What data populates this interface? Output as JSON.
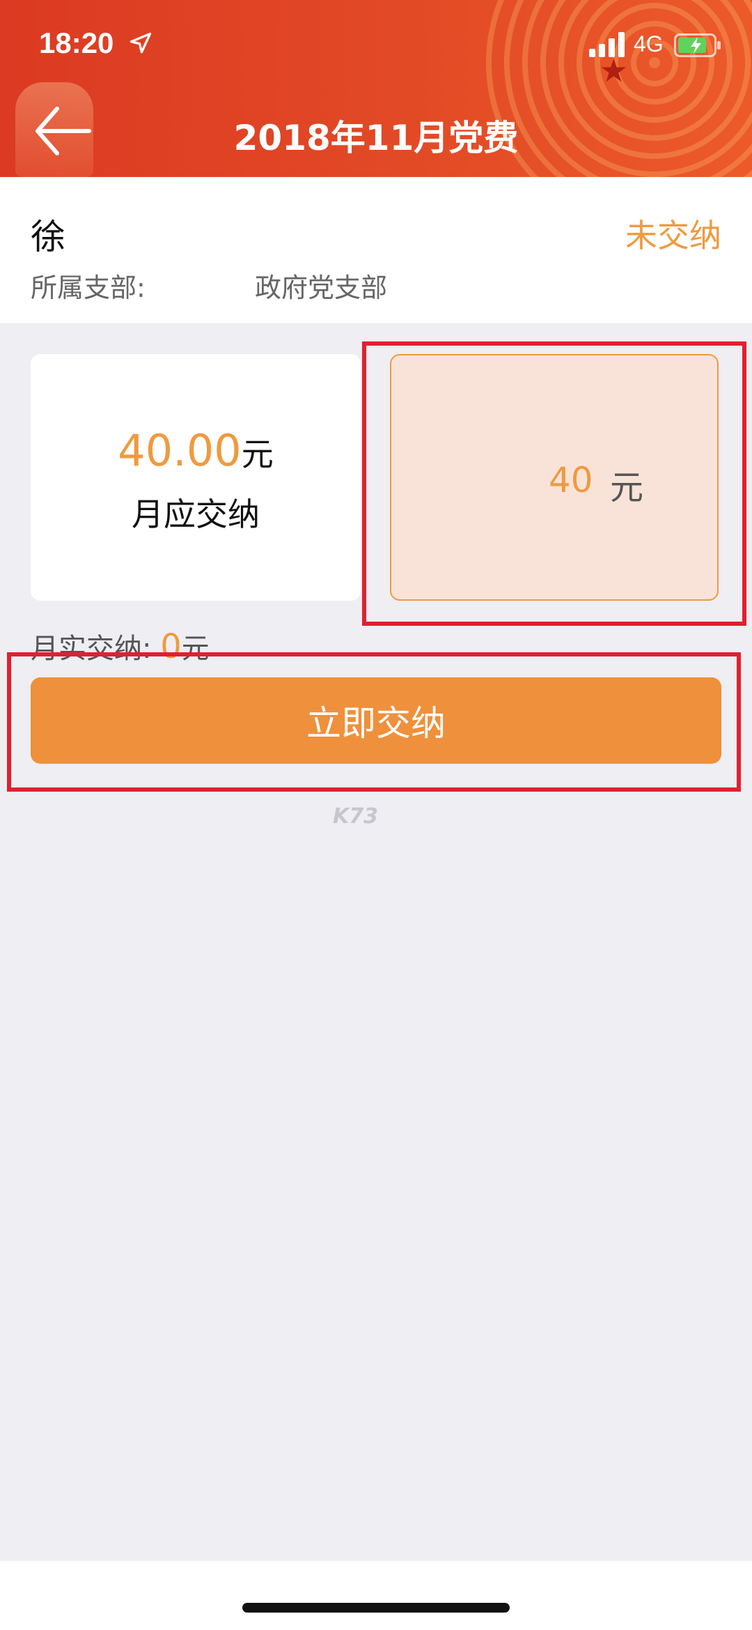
{
  "status_bar": {
    "time": "18:20",
    "network": "4G"
  },
  "header": {
    "title": "2018年11月党费"
  },
  "member": {
    "name": "徐",
    "status": "未交纳",
    "branch_label": "所属支部:",
    "branch_value": "政府党支部"
  },
  "due_card": {
    "amount": "40.00",
    "unit": "元",
    "label": "月应交纳"
  },
  "input_card": {
    "value": "40",
    "unit": "元"
  },
  "paid": {
    "label": "月实交纳:",
    "amount": "0",
    "unit": "元"
  },
  "pay_button": {
    "label": "立即交纳"
  },
  "watermark": "K73",
  "colors": {
    "header": "#e24a26",
    "accent": "#ef9a3f",
    "button": "#ef903c",
    "highlight_box": "#e02030"
  },
  "icons": [
    "back-arrow-icon",
    "location-arrow-icon",
    "signal-icon",
    "battery-charging-icon"
  ]
}
